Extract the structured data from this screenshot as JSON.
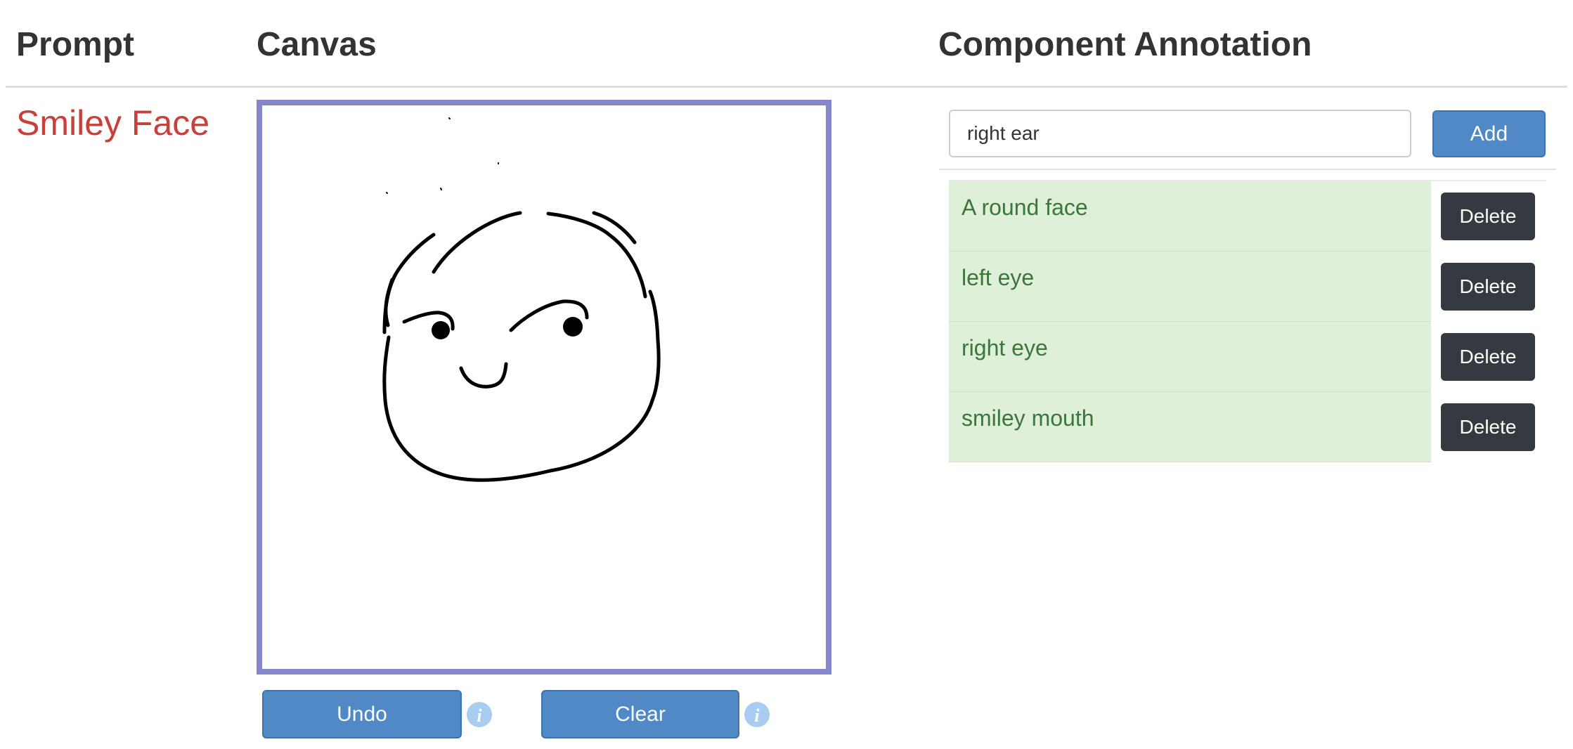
{
  "headers": {
    "prompt": "Prompt",
    "canvas": "Canvas",
    "annotation": "Component Annotation"
  },
  "prompt": {
    "text": "Smiley Face",
    "color": "#c9403a"
  },
  "canvas": {
    "border_color": "#8686cd",
    "undo_label": "Undo",
    "clear_label": "Clear"
  },
  "annotation": {
    "input_value": "right ear",
    "add_label": "Add",
    "items": [
      {
        "label": "A round face",
        "delete_label": "Delete"
      },
      {
        "label": "left eye",
        "delete_label": "Delete"
      },
      {
        "label": "right eye",
        "delete_label": "Delete"
      },
      {
        "label": "smiley mouth",
        "delete_label": "Delete"
      }
    ],
    "item_bg": "#dff0d8",
    "item_text_color": "#3c763d"
  },
  "colors": {
    "primary_button": "#5189c6",
    "dark_button": "#343a40",
    "info_icon": "#a9cdf0"
  }
}
